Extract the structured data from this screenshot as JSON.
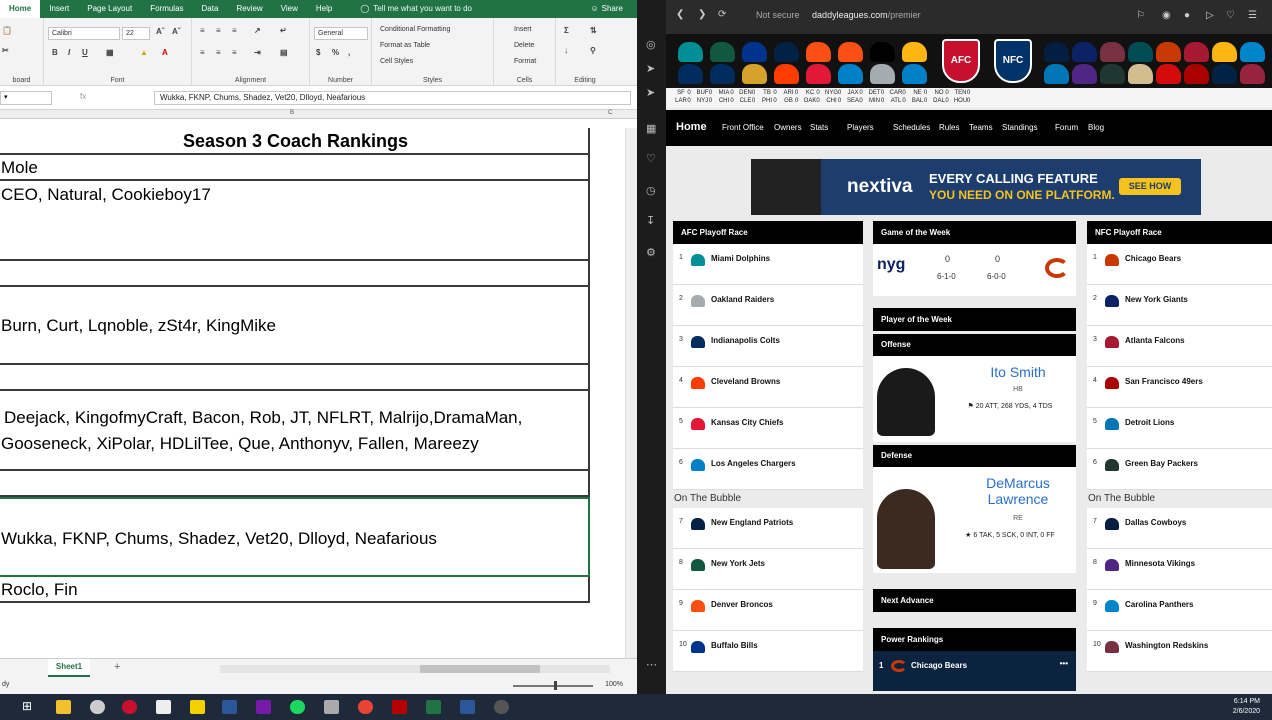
{
  "excel": {
    "tabs": [
      "Home",
      "Insert",
      "Page Layout",
      "Formulas",
      "Data",
      "Review",
      "View",
      "Help"
    ],
    "tell_me": "Tell me what you want to do",
    "share": "Share",
    "ribbon": {
      "font_name": "Calibri",
      "font_size": "22",
      "number_format": "General",
      "conditional_formatting": "Conditional Formatting",
      "format_as_table": "Format as Table",
      "cell_styles": "Cell Styles",
      "insert": "Insert",
      "delete": "Delete",
      "format": "Format",
      "groups": [
        "board",
        "Font",
        "Alignment",
        "Number",
        "Styles",
        "Cells",
        "Editing"
      ]
    },
    "formula_bar": {
      "fx": "fx",
      "value": "Wukka, FKNP, Chums, Shadez, Vet20, Dlloyd, Neafarious"
    },
    "column_headers": [
      "B",
      "C"
    ],
    "rows": [
      "Season 3 Coach Rankings",
      "Mole",
      "CEO, Natural, Cookieboy17",
      "",
      "Burn, Curt, Lqnoble, zSt4r, KingMike",
      "",
      "Deejack, KingofmyCraft, Bacon, Rob, JT, NFLRT, Malrijo,DramaMan,",
      "Gooseneck, XiPolar, HDLilTee, Que, Anthonyv, Fallen, Mareezy",
      "",
      "Wukka, FKNP, Chums, Shadez, Vet20, Dlloyd, Neafarious",
      "Roclo,  Fin"
    ],
    "sheet_tab": "Sheet1",
    "add_sheet": "+",
    "zoom": "100%",
    "status": "dy"
  },
  "browser": {
    "not_secure": "Not secure",
    "domain": "daddyleagues.com",
    "path": "/premier",
    "scores": [
      "SF",
      "LAR",
      "BUF",
      "NYJ",
      "MIA",
      "CHI",
      "DEN",
      "CLE",
      "TB",
      "PHI",
      "ARI",
      "GB",
      "KC",
      "OAK",
      "NYG",
      "CHI",
      "JAX",
      "SEA",
      "DET",
      "MIN",
      "CAR",
      "ATL",
      "NE",
      "BAL",
      "NO",
      "DAL",
      "TEN",
      "HOU"
    ],
    "score_vals": [
      "0",
      "0",
      "0",
      "0",
      "0",
      "0",
      "0",
      "0",
      "0",
      "0",
      "0",
      "0",
      "0",
      "0",
      "0",
      "0",
      "0",
      "0",
      "0",
      "0",
      "0",
      "0",
      "0",
      "0",
      "0",
      "0",
      "0",
      "0"
    ],
    "nav": [
      "Home",
      "Front Office",
      "Owners",
      "Stats",
      "Players",
      "Schedules",
      "Rules",
      "Teams",
      "Standings",
      "Forum",
      "Blog"
    ],
    "ad": {
      "brand": "nextiva",
      "line1": "EVERY CALLING FEATURE",
      "line2": "YOU NEED ON ONE PLATFORM.",
      "cta": "SEE HOW"
    },
    "afc_title": "AFC Playoff Race",
    "nfc_title": "NFC Playoff Race",
    "bubble": "On The Bubble",
    "afc": [
      {
        "rank": "1",
        "name": "Miami Dolphins",
        "color": "#008e97"
      },
      {
        "rank": "2",
        "name": "Oakland Raiders",
        "color": "#a5acaf"
      },
      {
        "rank": "3",
        "name": "Indianapolis Colts",
        "color": "#002c5f"
      },
      {
        "rank": "4",
        "name": "Cleveland Browns",
        "color": "#ff3c00"
      },
      {
        "rank": "5",
        "name": "Kansas City Chiefs",
        "color": "#e31837"
      },
      {
        "rank": "6",
        "name": "Los Angeles Chargers",
        "color": "#0080c6"
      }
    ],
    "afc_bubble": [
      {
        "rank": "7",
        "name": "New England Patriots",
        "color": "#002244"
      },
      {
        "rank": "8",
        "name": "New York Jets",
        "color": "#125740"
      },
      {
        "rank": "9",
        "name": "Denver Broncos",
        "color": "#fb4f14"
      },
      {
        "rank": "10",
        "name": "Buffalo Bills",
        "color": "#00338d"
      }
    ],
    "nfc": [
      {
        "rank": "1",
        "name": "Chicago Bears",
        "color": "#c83803"
      },
      {
        "rank": "2",
        "name": "New York Giants",
        "color": "#0b2265"
      },
      {
        "rank": "3",
        "name": "Atlanta Falcons",
        "color": "#a71930"
      },
      {
        "rank": "4",
        "name": "San Francisco 49ers",
        "color": "#aa0000"
      },
      {
        "rank": "5",
        "name": "Detroit Lions",
        "color": "#0076b6"
      },
      {
        "rank": "6",
        "name": "Green Bay Packers",
        "color": "#203731"
      }
    ],
    "nfc_bubble": [
      {
        "rank": "7",
        "name": "Dallas Cowboys",
        "color": "#041e42"
      },
      {
        "rank": "8",
        "name": "Minnesota Vikings",
        "color": "#4f2683"
      },
      {
        "rank": "9",
        "name": "Carolina Panthers",
        "color": "#0085ca"
      },
      {
        "rank": "10",
        "name": "Washington Redskins",
        "color": "#773141"
      }
    ],
    "gotw": {
      "title": "Game of the Week",
      "away": "nyg",
      "away_score": "0",
      "away_record": "6-1-0",
      "home_score": "0",
      "home_record": "6-0-0"
    },
    "potw": {
      "title": "Player of the Week",
      "offense_label": "Offense",
      "offense_name": "Ito Smith",
      "offense_pos": "HB",
      "offense_stat": "20 ATT, 268 YDS, 4 TDS",
      "defense_label": "Defense",
      "defense_name": "DeMarcus Lawrence",
      "defense_pos": "RE",
      "defense_stat": "6 TAK, 5 SCK, 0 INT, 0 FF"
    },
    "next_advance": "Next Advance",
    "power_rankings": "Power Rankings",
    "pr_first": {
      "rank": "1",
      "name": "Chicago Bears"
    }
  },
  "taskbar": {
    "time": "6:14 PM",
    "date": "2/6/2020"
  }
}
